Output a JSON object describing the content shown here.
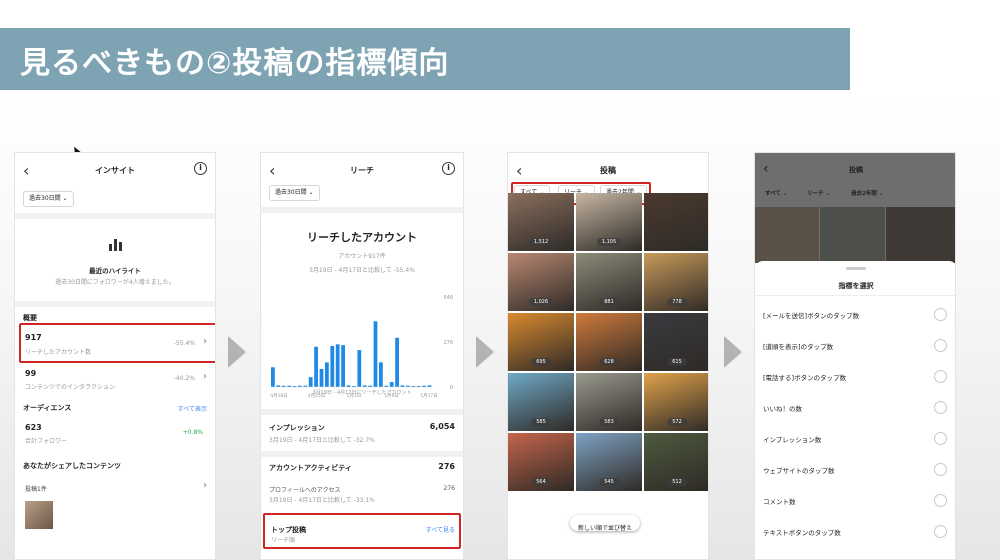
{
  "slide": {
    "title": "見るべきもの②投稿の指標傾向"
  },
  "colors": {
    "title_bg": "#7ea3b3",
    "highlight_red": "#d32424",
    "bar_blue": "#1f8ae6",
    "link_blue": "#3b82f6",
    "positive_green": "#2aa84a"
  },
  "screen1": {
    "back": "‹",
    "title": "インサイト",
    "info": "i",
    "period": "過去30日間 ⌄",
    "highlight_title": "最近のハイライト",
    "highlight_sub": "過去30日間にフォロワーが4人増えました。",
    "overview": "概要",
    "reach_value": "917",
    "reach_label": "リーチしたアカウント数",
    "reach_change": "-55.4%",
    "interaction_value": "99",
    "interaction_label": "コンテンツでのインタラクション",
    "interaction_change": "-40.2%",
    "audience": "オーディエンス",
    "show_all": "すべて表示",
    "followers_value": "623",
    "followers_label": "合計フォロワー",
    "followers_change": "+0.8%",
    "shared_content": "あなたがシェアしたコンテンツ",
    "posts_count": "投稿1件"
  },
  "screen2": {
    "back": "‹",
    "title": "リーチ",
    "info": "i",
    "period": "過去30日間 ⌄",
    "heading": "リーチしたアカウント",
    "sub1": "アカウント917件",
    "sub2": "3月19日 - 4月17日と比較して -55.4%",
    "chart_caption": "3月19日 - 4月17日にリーチしたアカウント",
    "impressions_label": "インプレッション",
    "impressions_value": "6,054",
    "impressions_sub": "3月19日 - 4月17日と比較して -32.7%",
    "activity_label": "アカウントアクティビティ",
    "activity_value": "276",
    "profile_label": "プロフィールへのアクセス",
    "profile_value": "276",
    "profile_sub": "3月19日 - 4月17日と比較して -33.1%",
    "top_posts_label": "トップ投稿",
    "top_posts_sub": "リーチ順",
    "top_posts_link": "すべて見る"
  },
  "chart_data": {
    "type": "bar",
    "title": "",
    "xlabel": "",
    "ylabel": "",
    "x_tick_labels": [
      "4月18日",
      "4月25日",
      "5月2日",
      "5月9日",
      "5月17日"
    ],
    "y_tick_labels": [
      "0",
      "276",
      "548"
    ],
    "ylim": [
      0,
      548
    ],
    "values": [
      120,
      10,
      8,
      8,
      6,
      8,
      8,
      60,
      245,
      110,
      150,
      250,
      260,
      255,
      10,
      6,
      225,
      10,
      8,
      400,
      150,
      8,
      30,
      300,
      10,
      8,
      6,
      6,
      8,
      10
    ],
    "grid": false,
    "legend": "none"
  },
  "screen3": {
    "back": "‹",
    "title": "投稿",
    "filter_type": "すべて ⌄",
    "filter_metric": "リーチ ⌄",
    "filter_period": "過去2年間 ⌄",
    "tiles": [
      {
        "count": "1,512",
        "color": "#8a6f5e"
      },
      {
        "count": "1,105",
        "color": "#c7b7a4"
      },
      {
        "count": "",
        "color": "#4b3a2f"
      },
      {
        "count": "1,026",
        "color": "#b98872"
      },
      {
        "count": "881",
        "color": "#8c8c7a"
      },
      {
        "count": "778",
        "color": "#c99a5a"
      },
      {
        "count": "695",
        "color": "#d98a2f"
      },
      {
        "count": "628",
        "color": "#d07a3a"
      },
      {
        "count": "615",
        "color": "#3a3a3f"
      },
      {
        "count": "585",
        "color": "#6fa9c7"
      },
      {
        "count": "583",
        "color": "#9a9a8e"
      },
      {
        "count": "572",
        "color": "#e0a24a"
      },
      {
        "count": "564",
        "color": "#c5654b"
      },
      {
        "count": "545",
        "color": "#7fa3c4"
      },
      {
        "count": "512",
        "color": "#4e5a3e"
      }
    ],
    "sort_button": "新しい順で並び替え"
  },
  "screen4": {
    "back": "‹",
    "title": "投稿",
    "filter_type": "すべて ⌄",
    "filter_metric": "リーチ ⌄",
    "filter_period": "過去2年間 ⌄",
    "sheet_title": "指標を選択",
    "options": [
      "[メールを送信]ボタンのタップ数",
      "[道順を表示]のタップ数",
      "[電話する]ボタンのタップ数",
      "いいね！の数",
      "インプレッション数",
      "ウェブサイトのタップ数",
      "コメント数",
      "テキストボタンのタップ数"
    ]
  }
}
